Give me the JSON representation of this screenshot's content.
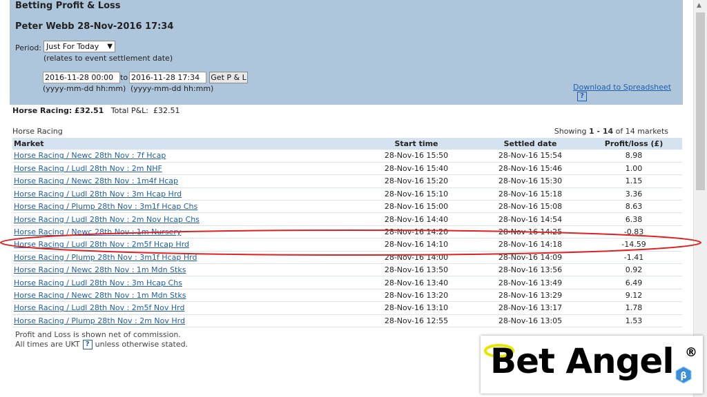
{
  "header": {
    "title": "Betting Profit & Loss",
    "subtitle": "Peter Webb 28-Nov-2016 17:34",
    "period_label": "Period:",
    "period_value": "Just For Today",
    "period_note": "(relates to event settlement date)",
    "date_from": "2016-11-28 00:00",
    "to_label": "to",
    "date_to": "2016-11-28 17:34",
    "get_button": "Get P & L",
    "format_hint_from": "(yyyy-mm-dd hh:mm)",
    "format_hint_to": "(yyyy-mm-dd hh:mm)",
    "download_link": "Download to Spreadsheet",
    "help_glyph": "?"
  },
  "summary": {
    "horse_racing_label": "Horse Racing:",
    "horse_racing_value": "£32.51",
    "total_label": "Total P&L:",
    "total_value": "£32.51"
  },
  "section": {
    "label": "Horse Racing",
    "showing_prefix": "Showing",
    "showing_range": "1 - 14",
    "showing_suffix": "of 14 markets"
  },
  "table": {
    "columns": [
      "Market",
      "Start time",
      "Settled date",
      "Profit/loss (£)"
    ],
    "rows": [
      [
        "Horse Racing / Newc 28th Nov : 7f Hcap",
        "28-Nov-16 15:50",
        "28-Nov-16 15:54",
        "8.98"
      ],
      [
        "Horse Racing / Ludl 28th Nov : 2m NHF",
        "28-Nov-16 15:40",
        "28-Nov-16 15:46",
        "1.00"
      ],
      [
        "Horse Racing / Newc 28th Nov : 1m4f Hcap",
        "28-Nov-16 15:20",
        "28-Nov-16 15:30",
        "1.15"
      ],
      [
        "Horse Racing / Ludl 28th Nov : 3m Hcap Hrd",
        "28-Nov-16 15:10",
        "28-Nov-16 15:18",
        "3.36"
      ],
      [
        "Horse Racing / Plump 28th Nov : 3m1f Hcap Chs",
        "28-Nov-16 15:00",
        "28-Nov-16 15:08",
        "8.63"
      ],
      [
        "Horse Racing / Ludl 28th Nov : 2m Nov Hcap Chs",
        "28-Nov-16 14:40",
        "28-Nov-16 14:54",
        "6.38"
      ],
      [
        "Horse Racing / Newc 28th Nov : 1m Nursery",
        "28-Nov-16 14:20",
        "28-Nov-16 14:25",
        "-0.83"
      ],
      [
        "Horse Racing / Ludl 28th Nov : 2m5f Hcap Hrd",
        "28-Nov-16 14:10",
        "28-Nov-16 14:18",
        "-14.59"
      ],
      [
        "Horse Racing / Plump 28th Nov : 3m1f Hcap Hrd",
        "28-Nov-16 14:00",
        "28-Nov-16 14:09",
        "-1.41"
      ],
      [
        "Horse Racing / Newc 28th Nov : 1m Mdn Stks",
        "28-Nov-16 13:50",
        "28-Nov-16 13:56",
        "0.92"
      ],
      [
        "Horse Racing / Ludl 28th Nov : 3m Hcap Chs",
        "28-Nov-16 13:40",
        "28-Nov-16 13:49",
        "6.49"
      ],
      [
        "Horse Racing / Newc 28th Nov : 1m Mdn Stks",
        "28-Nov-16 13:20",
        "28-Nov-16 13:29",
        "9.12"
      ],
      [
        "Horse Racing / Ludl 28th Nov : 2m5f Nov Hrd",
        "28-Nov-16 13:10",
        "28-Nov-16 13:17",
        "1.78"
      ],
      [
        "Horse Racing / Plump 28th Nov : 2m Nov Hrd",
        "28-Nov-16 12:55",
        "28-Nov-16 13:05",
        "1.53"
      ]
    ]
  },
  "footnotes": {
    "line1": "Profit and Loss is shown net of commission.",
    "line2_before": "All times are UKT",
    "line2_after": "unless otherwise stated."
  },
  "logo": {
    "text": "Bet Angel",
    "registered": "®"
  },
  "colors": {
    "header_bg": "#aec6dc",
    "table_header_bg": "#d4e3ef",
    "link": "#1f5ea8",
    "annotation": "#e02020"
  }
}
